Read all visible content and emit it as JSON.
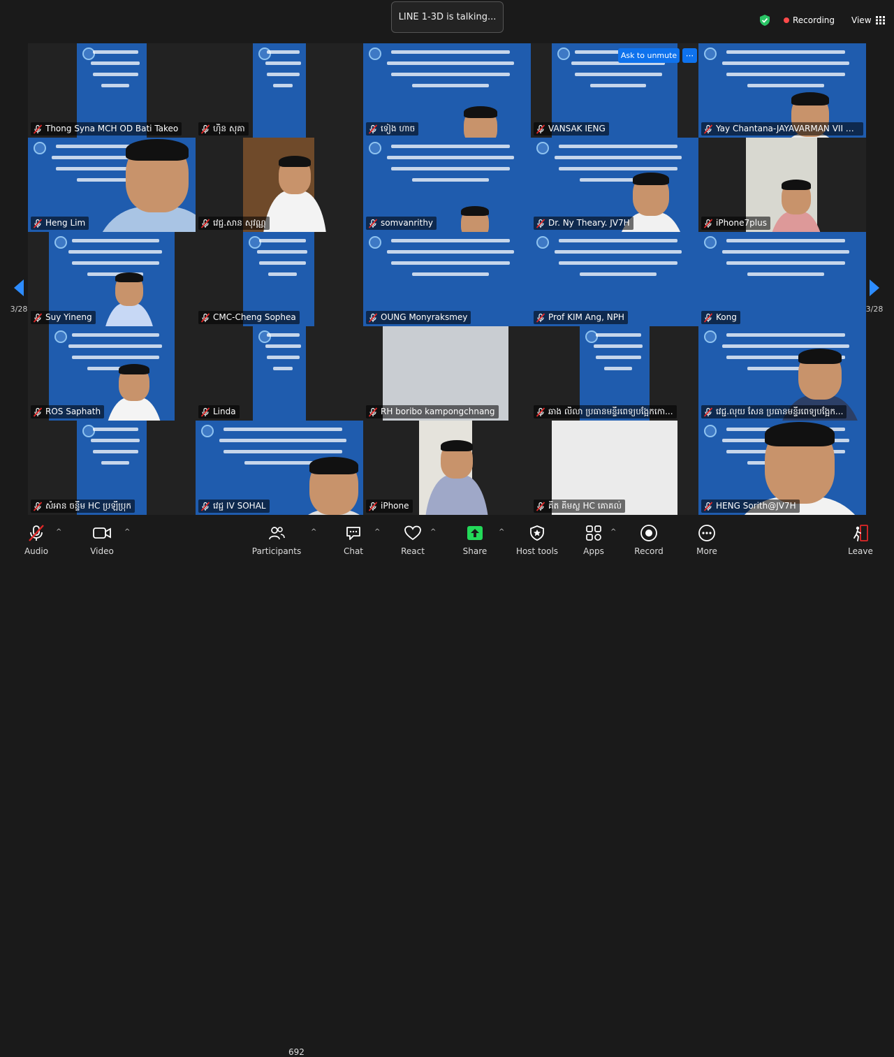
{
  "talking_indicator": "LINE 1-3D is talking...",
  "recording_label": "Recording",
  "view_label": "View",
  "ask_to_unmute": "Ask to unmute",
  "more_dots": "···",
  "page_indicator_left": "3/28",
  "page_indicator_right": "3/28",
  "participant_count": "692",
  "colors": {
    "accent": "#0e72ed",
    "slide_blue": "#1f5cae",
    "share_green": "#23d959",
    "rec_red": "#ff4a4a",
    "muted_red": "#e02828"
  },
  "participants": [
    "Thong Syna  MCH OD Bati Takeo",
    "ហ៊ិន សុគា",
    "ទៀង ហាច",
    "VANSAK IENG",
    "Yay Chantana-JAYAVARMAN VII Hos...",
    "Heng Lim",
    "វេជ្ជ.សាន សុវណ្ណ",
    "somvanrithy",
    "Dr. Ny Theary. JV7H",
    "iPhone7plus",
    "Suy Yineng",
    "CMC-Cheng Sophea",
    "OUNG Monyraksmey",
    "Prof KIM Ang, NPH",
    "Kong",
    "ROS Saphath",
    "Linda",
    "RH boribo kampongchnang",
    "ឆាង លិលា ប្រធានមន្ទីរពេទ្យបង្អែកកោ...",
    "វេជ្ជ.លុយ សែន ប្រធានមន្ទីរពេទ្យបង្អែក...",
    "សំអាន ចន្ទីម HC ប្រឡឺប្រុក",
    "វេជ្ជ IV SOHAL",
    "iPhone",
    "គីត គឹមស្ល HC គោគល់",
    "HENG Sorith@JV7H"
  ],
  "toolbar": {
    "audio": "Audio",
    "video": "Video",
    "participants": "Participants",
    "chat": "Chat",
    "react": "React",
    "share": "Share",
    "host_tools": "Host tools",
    "apps": "Apps",
    "record": "Record",
    "more": "More",
    "leave": "Leave"
  }
}
